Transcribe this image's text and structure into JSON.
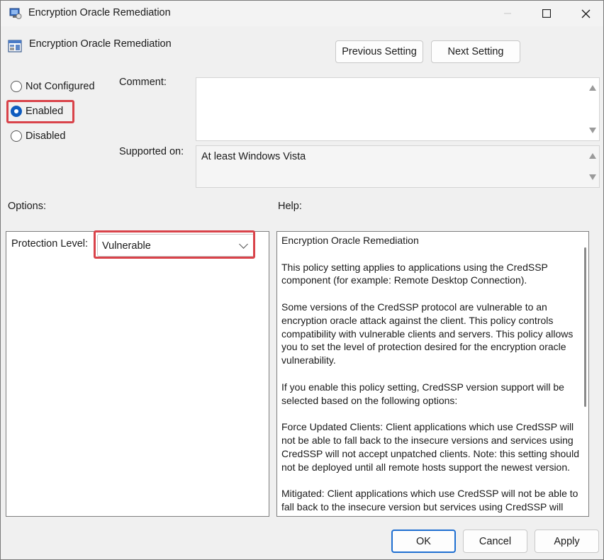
{
  "window": {
    "title": "Encryption Oracle Remediation",
    "icons": {
      "app": "policy-app-icon",
      "minimize": "minimize-icon",
      "maximize": "maximize-icon",
      "close": "close-icon"
    }
  },
  "header": {
    "policy_name": "Encryption Oracle Remediation",
    "policy_icon": "policy-settings-icon",
    "prev_label": "Previous Setting",
    "next_label": "Next Setting"
  },
  "state": {
    "options": [
      {
        "label": "Not Configured",
        "selected": false
      },
      {
        "label": "Enabled",
        "selected": true
      },
      {
        "label": "Disabled",
        "selected": false
      }
    ]
  },
  "comment": {
    "label": "Comment:",
    "value": ""
  },
  "supported": {
    "label": "Supported on:",
    "value": "At least Windows Vista"
  },
  "options_panel": {
    "title": "Options:",
    "protection_label": "Protection Level:",
    "protection_value": "Vulnerable"
  },
  "help_panel": {
    "title": "Help:",
    "paragraphs": [
      "Encryption Oracle Remediation",
      "This policy setting applies to applications using the CredSSP component (for example: Remote Desktop Connection).",
      "Some versions of the CredSSP protocol are vulnerable to an encryption oracle attack against the client.  This policy controls compatibility with vulnerable clients and servers.  This policy allows you to set the level of protection desired for the encryption oracle vulnerability.",
      "If you enable this policy setting, CredSSP version support will be selected based on the following options:",
      "Force Updated Clients: Client applications which use CredSSP will not be able to fall back to the insecure versions and services using CredSSP will not accept unpatched clients. Note: this setting should not be deployed until all remote hosts support the newest version.",
      "Mitigated: Client applications which use CredSSP will not be able to fall back to the insecure version but services using CredSSP will accept unpatched clients."
    ]
  },
  "footer": {
    "ok_label": "OK",
    "cancel_label": "Cancel",
    "apply_label": "Apply"
  },
  "colors": {
    "accent": "#0f5cbf",
    "highlight": "#d9434a"
  }
}
